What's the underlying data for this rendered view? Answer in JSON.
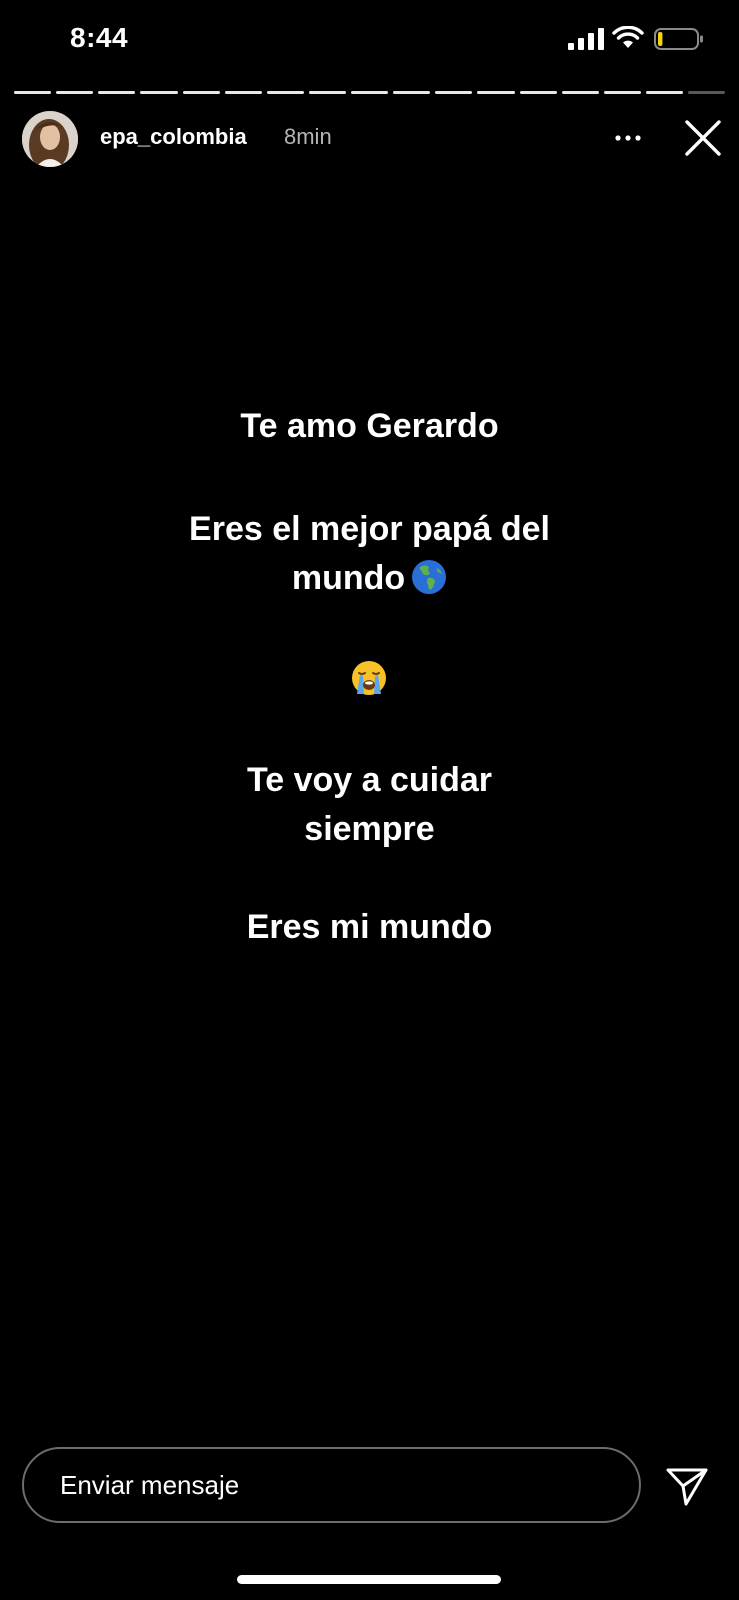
{
  "status_bar": {
    "time": "8:44",
    "signal_icon": "cellular-signal-icon",
    "wifi_icon": "wifi-icon",
    "battery_icon": "battery-low-icon",
    "battery_level": 0.12,
    "battery_color": "#f5d20a"
  },
  "story": {
    "segments_total": 17,
    "segments_completed": 16,
    "current_segment_progress": 0.0,
    "username": "epa_colombia",
    "time_ago": "8min",
    "more_icon": "more-horizontal-icon",
    "close_icon": "close-icon",
    "lines": {
      "line1": "Te amo Gerardo",
      "line2a": "Eres el mejor papá del",
      "line2b": "mundo",
      "globe_emoji": "globe-americas-emoji",
      "crying_emoji": "loudly-crying-face-emoji",
      "line3a": "Te voy a cuidar",
      "line3b": "siempre",
      "line4": "Eres mi mundo"
    }
  },
  "message_bar": {
    "placeholder": "Enviar mensaje",
    "send_icon": "send-paper-plane-icon"
  },
  "colors": {
    "background": "#000000",
    "text": "#ffffff",
    "muted": "#b5b5b5",
    "input_border": "#6c6c6c"
  }
}
